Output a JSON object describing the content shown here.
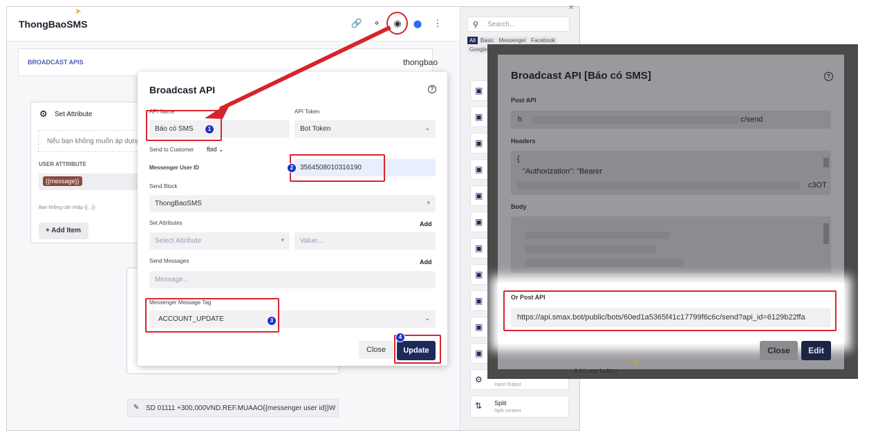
{
  "app": {
    "title": "ThongBaoSMS",
    "header_icons": [
      "link-icon",
      "tag-icon",
      "dollar-icon",
      "messenger-icon",
      "more-vertical-icon"
    ],
    "broadcast_bar": {
      "label": "BROADCAST APIS",
      "value": "thongbao"
    },
    "set_attribute": {
      "title": "Set Attribute",
      "note": "Nếu bạn không muốn áp dụng",
      "user_attribute_label": "USER ATTRIBUTE",
      "chip": "{{message}}",
      "hint": "Bạn không cần nhập {{...}}",
      "add_item": "+ Add Item"
    },
    "sms_template": "SD 01111 +300,000VND.REF.MUAAO{{messenger user id}}W",
    "sidebar": {
      "search_placeholder": "Search...",
      "tabs": [
        "All",
        "Basic",
        "Messenger",
        "Facebook",
        "Google"
      ],
      "split": {
        "title": "Split",
        "subtitle": "Split content"
      },
      "partial_label": "Input Output"
    }
  },
  "modal": {
    "title": "Broadcast API",
    "api_name_label": "API Name",
    "api_name_value": "Báo có SMS",
    "api_token_label": "API Token",
    "api_token_value": "Bot Token",
    "send_to_label": "Send to Customer",
    "send_to_value": "fbid",
    "messenger_user_id_label": "Messenger User ID",
    "messenger_user_id_value": "3564508010316190",
    "send_block_label": "Send Block",
    "send_block_value": "ThongBaoSMS",
    "set_attributes_label": "Set Attributes",
    "add_label": "Add",
    "select_attribute_placeholder": "Select Attribute",
    "value_placeholder": "Value...",
    "send_messages_label": "Send Messages",
    "message_placeholder": "Message...",
    "message_tag_label": "Messenger Message Tag",
    "message_tag_value": "ACCOUNT_UPDATE",
    "close_label": "Close",
    "update_label": "Update"
  },
  "badges": [
    "1",
    "2",
    "3",
    "4"
  ],
  "right_panel": {
    "title": "Broadcast API  [Báo có SMS]",
    "post_api_label": "Post API",
    "post_api_start": "h",
    "post_api_end": "c/send",
    "headers_label": "Headers",
    "headers_line1": "{",
    "headers_line2": "\"Authorization\": \"Bearer",
    "headers_line3_end": "c3OT",
    "body_label": "Body",
    "or_post_api_label": "Or Post API",
    "or_post_api_url": "https://api.smax.bot/public/bots/60ed1a5365f41c17799f6c6c/send?api_id=6129b22ffa",
    "close_label": "Close",
    "edit_label": "Edit",
    "add_new_button": "Add new button"
  },
  "colors": {
    "annotation_red": "#d6242b",
    "badge_blue": "#1c33c9",
    "primary": "#1d2a5b"
  }
}
